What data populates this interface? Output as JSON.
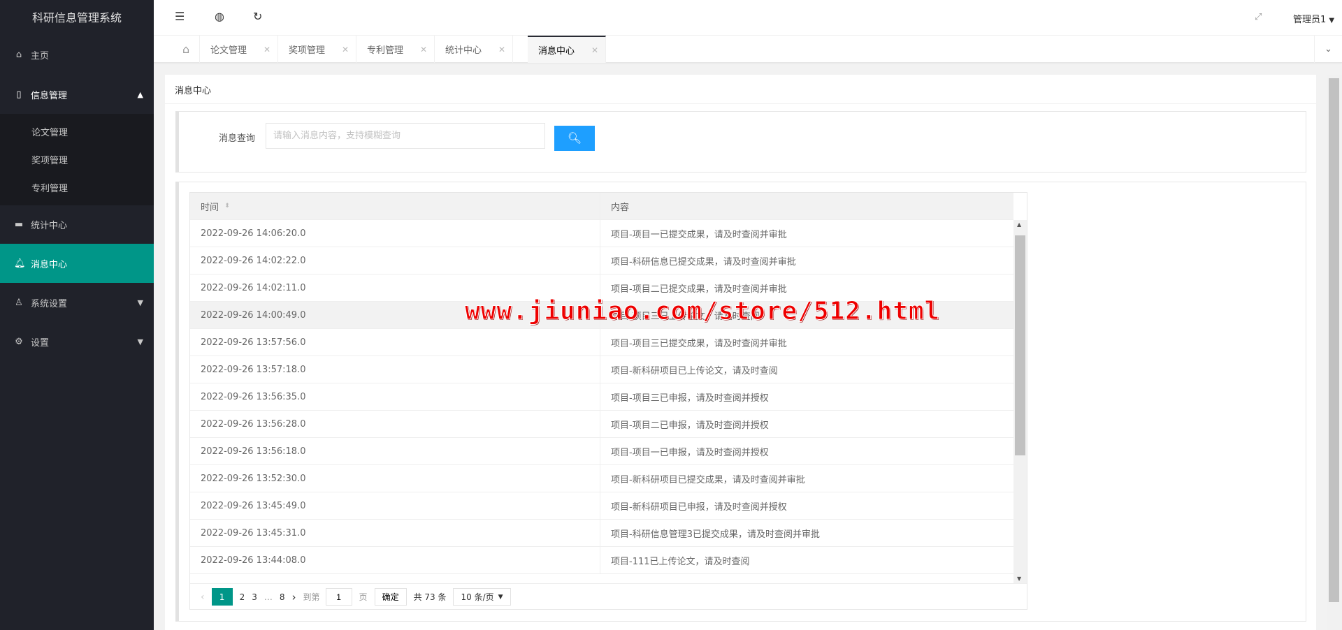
{
  "app": {
    "title": "科研信息管理系统"
  },
  "sidebar": {
    "items": [
      {
        "label": "主页",
        "icon": "home-icon"
      },
      {
        "label": "信息管理",
        "icon": "note-icon",
        "children": [
          "论文管理",
          "奖项管理",
          "专利管理"
        ]
      },
      {
        "label": "统计中心",
        "icon": "monitor-icon"
      },
      {
        "label": "消息中心",
        "icon": "bell-icon"
      },
      {
        "label": "系统设置",
        "icon": "user-icon"
      },
      {
        "label": "设置",
        "icon": "gear-icon"
      }
    ]
  },
  "header": {
    "user": "管理员1"
  },
  "tabs": [
    {
      "label": "论文管理"
    },
    {
      "label": "奖项管理"
    },
    {
      "label": "专利管理"
    },
    {
      "label": "统计中心"
    },
    {
      "label": "消息中心"
    }
  ],
  "page": {
    "title": "消息中心"
  },
  "search": {
    "label": "消息查询",
    "placeholder": "请输入消息内容，支持模糊查询",
    "value": ""
  },
  "table": {
    "headers": [
      "时间",
      "内容"
    ],
    "rows": [
      [
        "2022-09-26 14:06:20.0",
        "项目-项目一已提交成果，请及时查阅并审批"
      ],
      [
        "2022-09-26 14:02:22.0",
        "项目-科研信息已提交成果，请及时查阅并审批"
      ],
      [
        "2022-09-26 14:02:11.0",
        "项目-项目二已提交成果，请及时查阅并审批"
      ],
      [
        "2022-09-26 14:00:49.0",
        "项目-项目三已上传论文，请及时查阅"
      ],
      [
        "2022-09-26 13:57:56.0",
        "项目-项目三已提交成果，请及时查阅并审批"
      ],
      [
        "2022-09-26 13:57:18.0",
        "项目-新科研项目已上传论文，请及时查阅"
      ],
      [
        "2022-09-26 13:56:35.0",
        "项目-项目三已申报，请及时查阅并授权"
      ],
      [
        "2022-09-26 13:56:28.0",
        "项目-项目二已申报，请及时查阅并授权"
      ],
      [
        "2022-09-26 13:56:18.0",
        "项目-项目一已申报，请及时查阅并授权"
      ],
      [
        "2022-09-26 13:52:30.0",
        "项目-新科研项目已提交成果，请及时查阅并审批"
      ],
      [
        "2022-09-26 13:45:49.0",
        "项目-新科研项目已申报，请及时查阅并授权"
      ],
      [
        "2022-09-26 13:45:31.0",
        "项目-科研信息管理3已提交成果，请及时查阅并审批"
      ],
      [
        "2022-09-26 13:44:08.0",
        "项目-111已上传论文，请及时查阅"
      ]
    ]
  },
  "pager": {
    "pages": [
      "1",
      "2",
      "3",
      "…",
      "8"
    ],
    "current": "1",
    "goto_label": "到第",
    "goto_value": "1",
    "page_suffix": "页",
    "confirm": "确定",
    "total": "共 73 条",
    "page_size": "10 条/页"
  },
  "watermark": "www.jiuniao.com/store/512.html"
}
